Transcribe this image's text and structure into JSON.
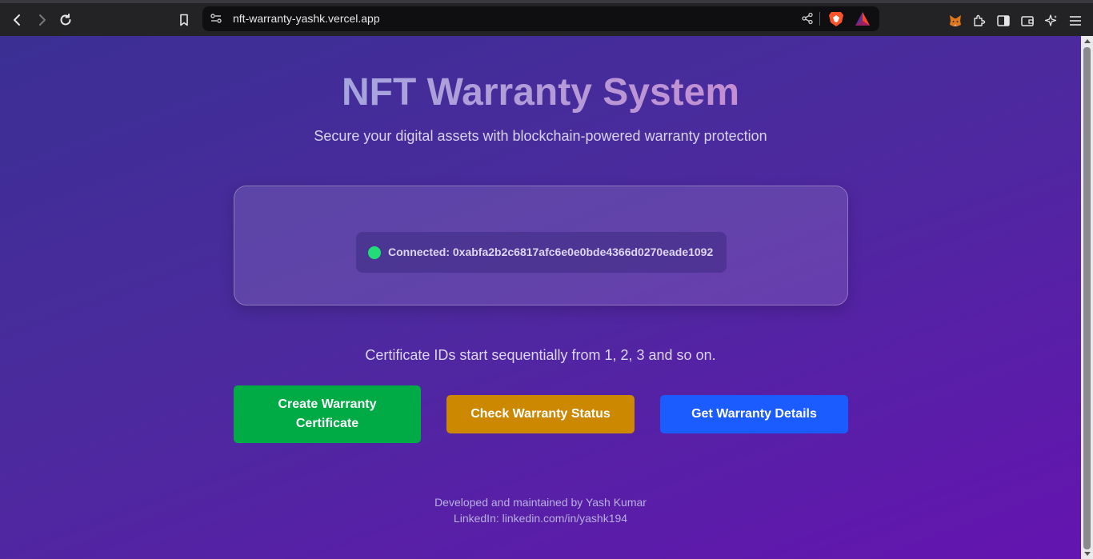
{
  "browser": {
    "url": "nft-warranty-yashk.vercel.app"
  },
  "page": {
    "title": "NFT Warranty System",
    "subtitle": "Secure your digital assets with blockchain-powered warranty protection",
    "connection": {
      "text": "Connected: 0xabfa2b2c6817afc6e0e0bde4366d0270eade1092",
      "status_color": "#22dd77"
    },
    "info": "Certificate IDs start sequentially from 1, 2, 3 and so on.",
    "buttons": {
      "create_line1": "Create Warranty",
      "create_line2": "Certificate",
      "check": "Check Warranty Status",
      "details": "Get Warranty Details"
    },
    "footer": {
      "credit": "Developed and maintained by Yash Kumar",
      "linkedin": "LinkedIn: linkedin.com/in/yashk194"
    }
  },
  "colors": {
    "create": "#00aa44",
    "check": "#cc8800",
    "details": "#1a5cff"
  }
}
